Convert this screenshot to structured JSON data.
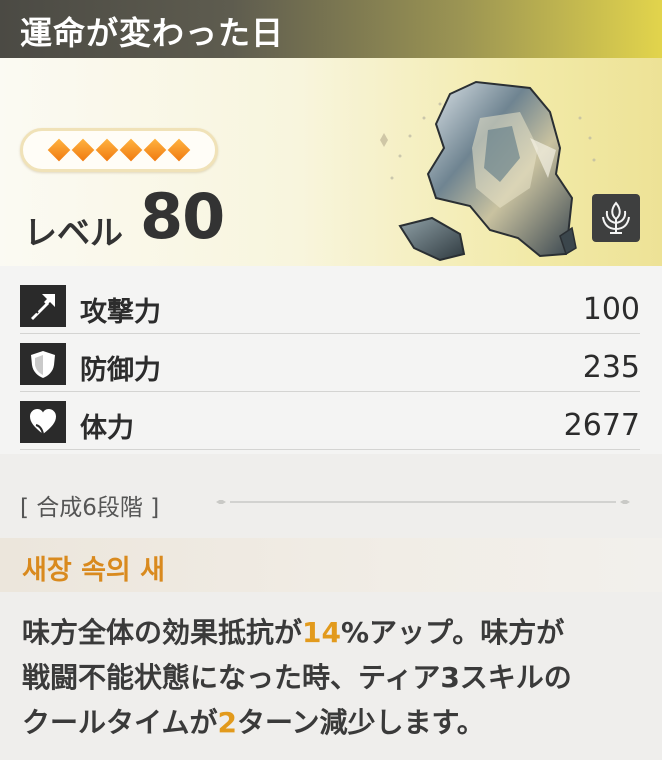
{
  "title": "運命が変わった日",
  "rarity_stars": 6,
  "level": {
    "label": "レベル",
    "value": "80"
  },
  "class_icon": "support-class-icon",
  "stats": [
    {
      "icon": "attack-icon",
      "label": "攻撃力",
      "value": "100"
    },
    {
      "icon": "defense-icon",
      "label": "防御力",
      "value": "235"
    },
    {
      "icon": "health-icon",
      "label": "体力",
      "value": "2677"
    }
  ],
  "stage": "[ 合成6段階 ]",
  "skill": {
    "name": "새장 속의 새",
    "desc_line1_a": "味方全体の効果抵抗が",
    "desc_line1_hl": "14",
    "desc_line1_b": "%アップ。味方が",
    "desc_line2": "戦闘不能状態になった時、ティア3スキルの",
    "desc_line3_a": "クールタイムが",
    "desc_line3_hl": "2",
    "desc_line3_b": "ターン減少します。"
  },
  "colors": {
    "highlight": "#e29a1c",
    "skill_name": "#d98a1e",
    "star": "#f07a10"
  }
}
